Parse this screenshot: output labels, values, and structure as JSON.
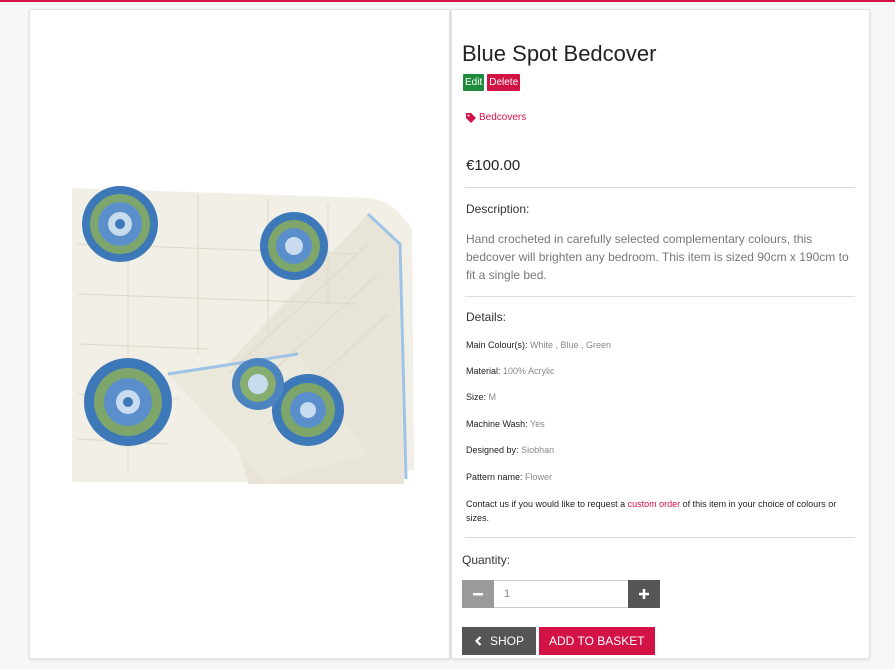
{
  "colors": {
    "accent": "#d31245",
    "edit_green": "#1e8a3c",
    "dark_button": "#555555",
    "muted_button": "#9a9a9a"
  },
  "product": {
    "title": "Blue Spot Bedcover",
    "image_alt": "crocheted white bedcover with blue and green flower motifs",
    "category_icon": "tag-icon",
    "category": "Bedcovers",
    "price": "€100.00"
  },
  "admin": {
    "edit_label": "Edit",
    "delete_label": "Delete"
  },
  "description": {
    "heading": "Description:",
    "text": "Hand crocheted in carefully selected complementary colours, this bedcover will brighten any bedroom. This item is sized 90cm x 190cm to fit a single bed."
  },
  "details": {
    "heading": "Details:",
    "rows": [
      {
        "label": "Main Colour(s):",
        "value": "White , Blue , Green"
      },
      {
        "label": "Material:",
        "value": "100% Acrylic"
      },
      {
        "label": "Size:",
        "value": "M"
      },
      {
        "label": "Machine Wash:",
        "value": "Yes"
      },
      {
        "label": "Designed by:",
        "value": "Siobhan"
      },
      {
        "label": "Pattern name:",
        "value": "Flower"
      }
    ],
    "contact_before": "Contact us if you would like to request a ",
    "contact_link": "custom order",
    "contact_after": " of this item in your choice of colours or sizes."
  },
  "quantity": {
    "label": "Quantity:",
    "value": "1",
    "minus_icon": "minus-icon",
    "plus_icon": "plus-icon"
  },
  "actions": {
    "shop_icon": "chevron-left-icon",
    "shop_label": "SHOP",
    "basket_label": "ADD TO BASKET"
  }
}
